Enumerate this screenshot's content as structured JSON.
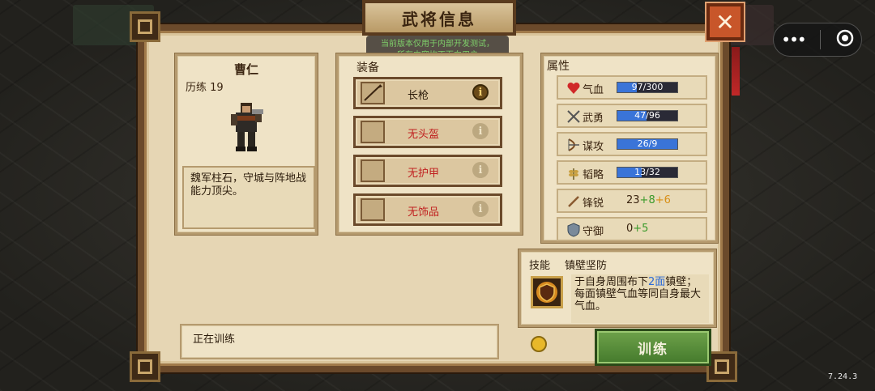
{
  "title": "武将信息",
  "dev_notice": {
    "line1": "当前版本仅用于内部开发测试，",
    "line2": "所有内容均不面向用户"
  },
  "close_icon": "close-icon",
  "hero": {
    "name": "曹仁",
    "training_label": "历练 19",
    "description": "魏军柱石，守城与阵地战能力顶尖。"
  },
  "equipment": {
    "title": "装备",
    "items": [
      {
        "name": "长枪",
        "equipped": true,
        "color": "#2a1a0a"
      },
      {
        "name": "无头盔",
        "equipped": false,
        "color": "#c02020"
      },
      {
        "name": "无护甲",
        "equipped": false,
        "color": "#c02020"
      },
      {
        "name": "无饰品",
        "equipped": false,
        "color": "#c02020"
      }
    ]
  },
  "attributes": {
    "title": "属性",
    "rows": [
      {
        "icon": "heart-icon",
        "label": "气血",
        "value": "97/300",
        "fraction": 0.323
      },
      {
        "icon": "swords-icon",
        "label": "武勇",
        "value": "47/96",
        "fraction": 0.49
      },
      {
        "icon": "bow-icon",
        "label": "谋攻",
        "value": "26/9",
        "fraction": 1.0
      },
      {
        "icon": "grain-icon",
        "label": "韬略",
        "value": "13/32",
        "fraction": 0.406
      }
    ],
    "sharp": {
      "label": "锋锐",
      "base": "23",
      "plus1": "+8",
      "plus2": "+6"
    },
    "defense": {
      "label": "守御",
      "base": "0",
      "plus1": "+5"
    }
  },
  "skill": {
    "label": "技能",
    "name": "镇壁坚防",
    "desc_pre": "于自身周围布下",
    "desc_highlight": "2面",
    "desc_post": "镇壁；每面镇壁气血等同自身最大气血。"
  },
  "status": {
    "text": "正在训练"
  },
  "train_button": "训练",
  "version": "7.24.3",
  "colors": {
    "accent_blue": "#3a74d8",
    "train_green": "#5a8e3a",
    "close_orange": "#c8562a"
  }
}
